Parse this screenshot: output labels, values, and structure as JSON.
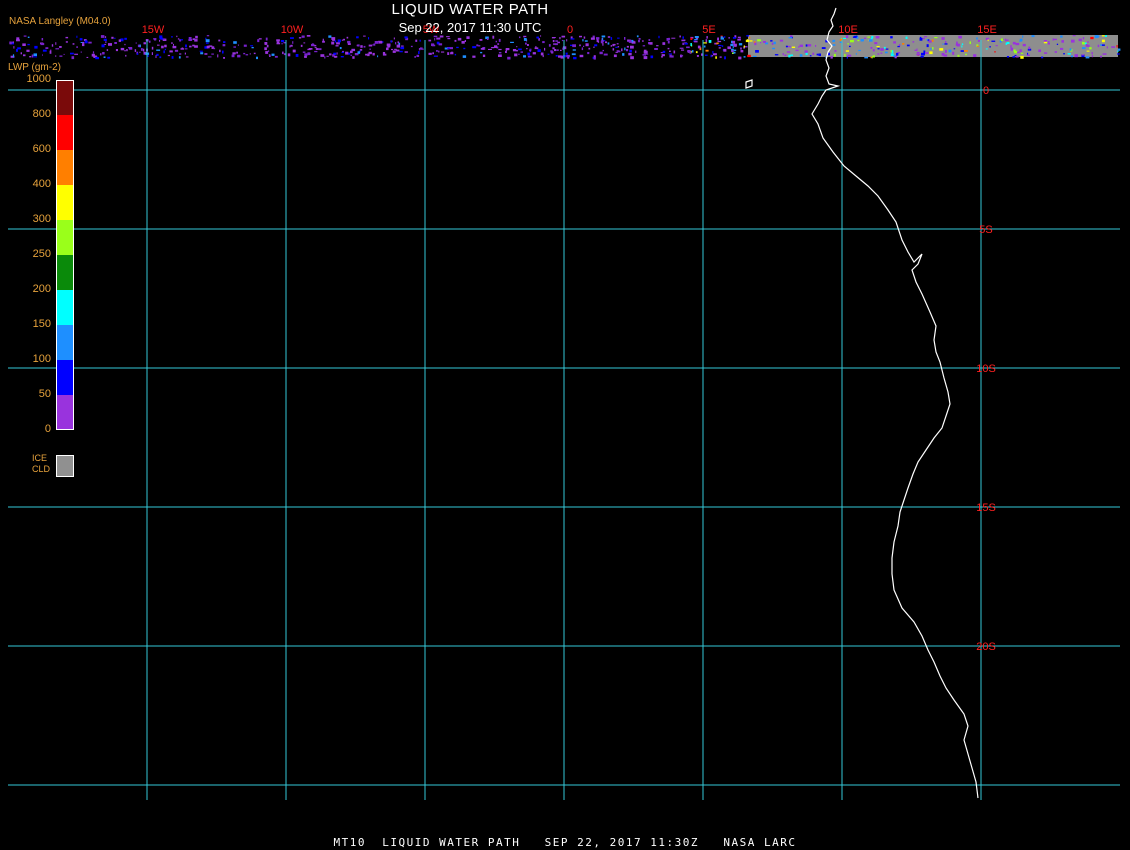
{
  "header": {
    "title": "LIQUID WATER PATH",
    "subtitle": "Sep 22, 2017 11:30 UTC",
    "source": "NASA Langley (M04.0)"
  },
  "legend": {
    "title": "LWP (gm-2)",
    "labels": [
      "1000",
      "800",
      "600",
      "400",
      "300",
      "250",
      "200",
      "150",
      "100",
      "50",
      "0"
    ],
    "colors": [
      "#7a0a0a",
      "#ff0000",
      "#ff7f00",
      "#ffff00",
      "#9aff1a",
      "#0a8a0a",
      "#00ffff",
      "#1e8fff",
      "#0000ff",
      "#9933dd"
    ],
    "ice_label_1": "ICE",
    "ice_label_2": "CLD",
    "ice_color": "#909090"
  },
  "map": {
    "lon_labels": [
      "15W",
      "10W",
      "5W",
      "0",
      "5E",
      "10E",
      "15E"
    ],
    "lat_labels": [
      "0",
      "5S",
      "10S",
      "15S",
      "20S"
    ],
    "grid_color": "#35c8d8",
    "label_color": "#ff2020"
  },
  "footer": {
    "text": "MT10  LIQUID WATER PATH   SEP 22, 2017 11:30Z   NASA LARC"
  }
}
